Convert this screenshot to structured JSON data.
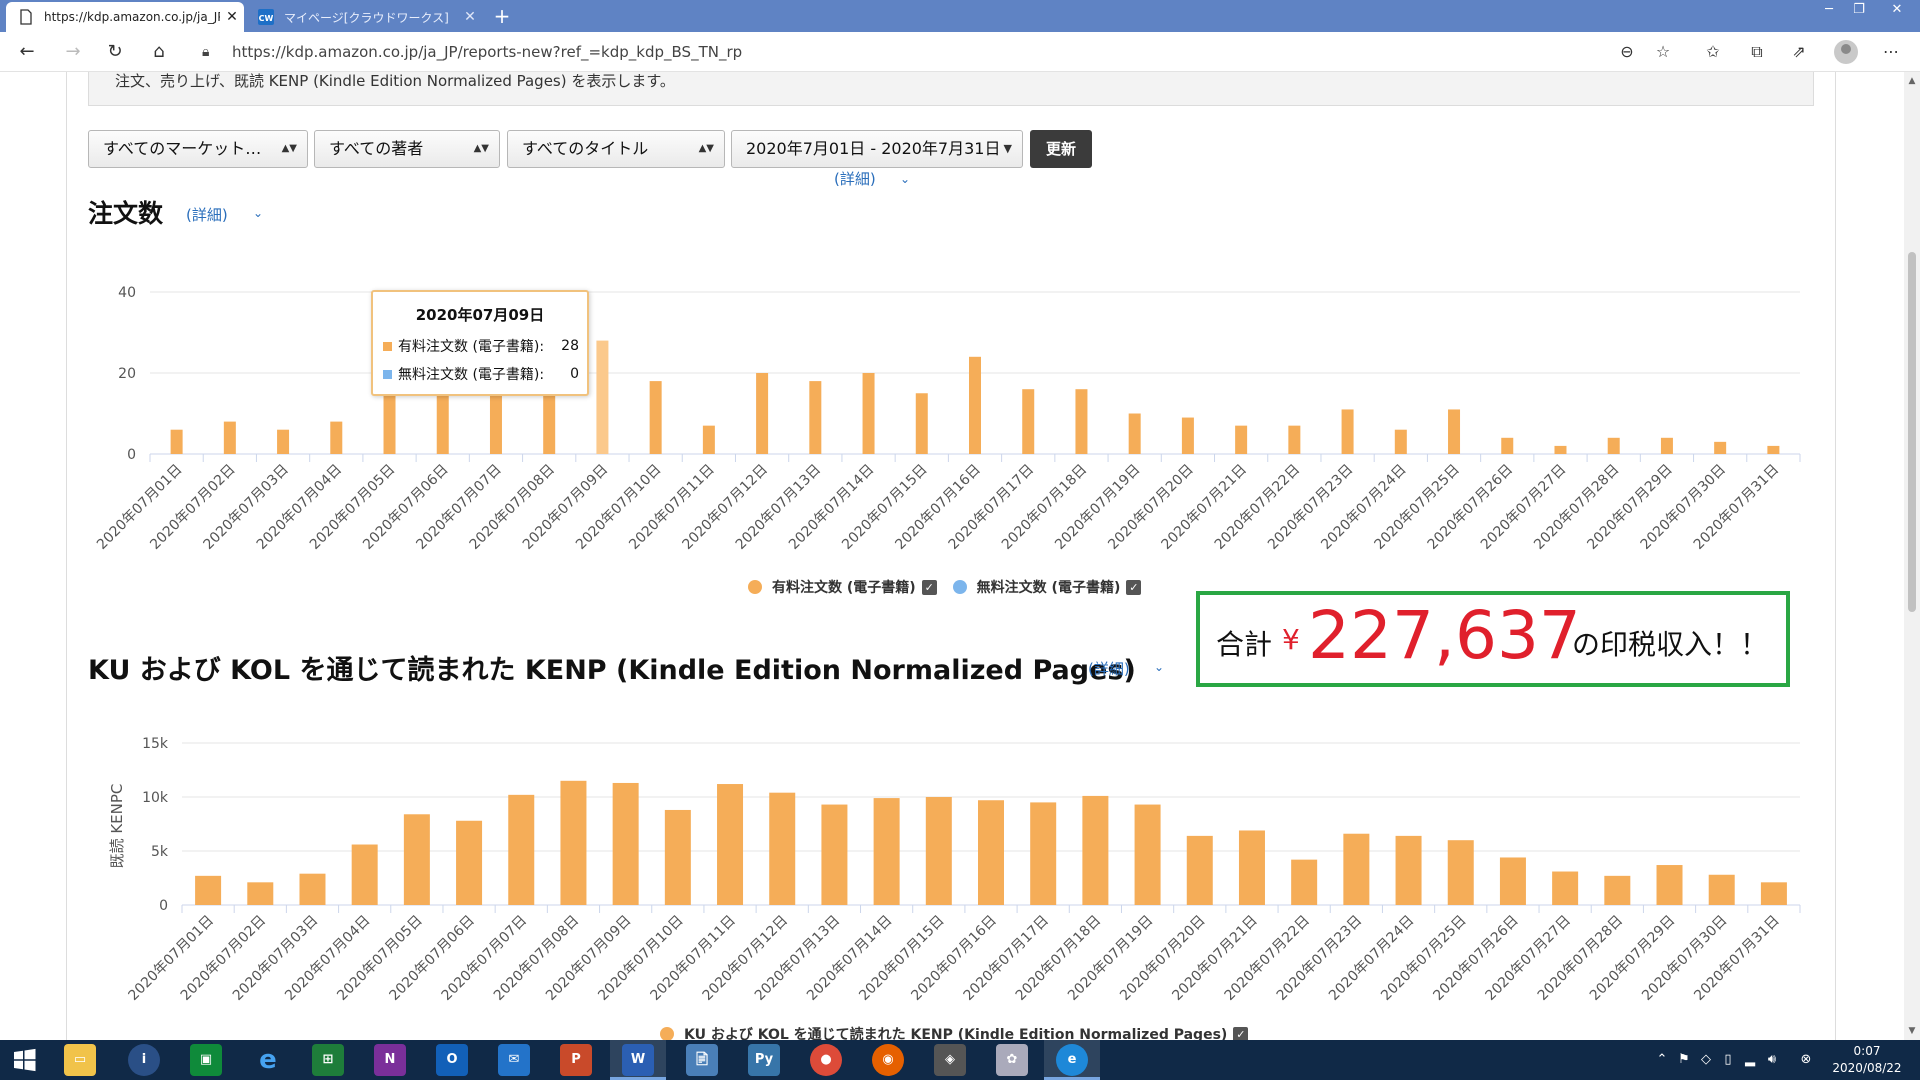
{
  "browser": {
    "tabs": [
      {
        "title": "https://kdp.amazon.co.jp/ja_JP/re",
        "active": true
      },
      {
        "title": "マイページ[クラウドワークス]",
        "active": false
      }
    ],
    "new_tab_label": "+",
    "url": "https://kdp.amazon.co.jp/ja_JP/reports-new?ref_=kdp_kdp_BS_TN_rp",
    "window_controls": [
      "─",
      "❐",
      "✕"
    ]
  },
  "page": {
    "info_text": "注文、売り上げ、既読 KENP (Kindle Edition Normalized Pages) を表示します。",
    "filters": {
      "marketplace": "すべてのマーケット…",
      "author": "すべての著者",
      "title": "すべてのタイトル",
      "date_range": "2020年7月01日 - 2020年7月31日",
      "update_button": "更新",
      "detail_label": "(詳細)"
    },
    "orders_section": {
      "title": "注文数",
      "detail_label": "(詳細)"
    },
    "kenp_section": {
      "title": "KU および KOL を通じて読まれた KENP (Kindle Edition Normalized Pages)",
      "detail_label": "(詳細)"
    },
    "tooltip": {
      "date": "2020年07月09日",
      "rows": [
        {
          "label": "有料注文数 (電子書籍):",
          "value": "28",
          "color": "#f5ad58"
        },
        {
          "label": "無料注文数 (電子書籍):",
          "value": "0",
          "color": "#7cb5ec"
        }
      ]
    },
    "annotation": {
      "prefix": "合計",
      "currency": "¥",
      "amount": "227,637",
      "suffix": "の印税収入！！"
    }
  },
  "chart_data": [
    {
      "type": "bar",
      "title": "注文数",
      "categories": [
        "2020年07月01日",
        "2020年07月02日",
        "2020年07月03日",
        "2020年07月04日",
        "2020年07月05日",
        "2020年07月06日",
        "2020年07月07日",
        "2020年07月08日",
        "2020年07月09日",
        "2020年07月10日",
        "2020年07月11日",
        "2020年07月12日",
        "2020年07月13日",
        "2020年07月14日",
        "2020年07月15日",
        "2020年07月16日",
        "2020年07月17日",
        "2020年07月18日",
        "2020年07月19日",
        "2020年07月20日",
        "2020年07月21日",
        "2020年07月22日",
        "2020年07月23日",
        "2020年07月24日",
        "2020年07月25日",
        "2020年07月26日",
        "2020年07月27日",
        "2020年07月28日",
        "2020年07月29日",
        "2020年07月30日",
        "2020年07月31日"
      ],
      "series": [
        {
          "name": "有料注文数 (電子書籍)",
          "color": "#f5ad58",
          "values": [
            6,
            8,
            6,
            8,
            20,
            22,
            22,
            22,
            28,
            18,
            7,
            20,
            18,
            20,
            15,
            24,
            16,
            16,
            10,
            9,
            7,
            7,
            11,
            6,
            11,
            4,
            2,
            4,
            4,
            3,
            2
          ]
        },
        {
          "name": "無料注文数 (電子書籍)",
          "color": "#7cb5ec",
          "values": [
            0,
            0,
            0,
            0,
            0,
            0,
            0,
            0,
            0,
            0,
            0,
            0,
            0,
            0,
            0,
            0,
            0,
            0,
            0,
            0,
            0,
            0,
            0,
            0,
            0,
            0,
            0,
            0,
            0,
            0,
            0
          ]
        }
      ],
      "yticks": [
        "0",
        "20",
        "40"
      ],
      "ylim": [
        0,
        40
      ],
      "highlight_index": 8,
      "grid": true,
      "legend": "bottom-center"
    },
    {
      "type": "bar",
      "title": "KU および KOL を通じて読まれた KENP (Kindle Edition Normalized Pages)",
      "ylabel": "既読 KENPC",
      "categories": [
        "2020年07月01日",
        "2020年07月02日",
        "2020年07月03日",
        "2020年07月04日",
        "2020年07月05日",
        "2020年07月06日",
        "2020年07月07日",
        "2020年07月08日",
        "2020年07月09日",
        "2020年07月10日",
        "2020年07月11日",
        "2020年07月12日",
        "2020年07月13日",
        "2020年07月14日",
        "2020年07月15日",
        "2020年07月16日",
        "2020年07月17日",
        "2020年07月18日",
        "2020年07月19日",
        "2020年07月20日",
        "2020年07月21日",
        "2020年07月22日",
        "2020年07月23日",
        "2020年07月24日",
        "2020年07月25日",
        "2020年07月26日",
        "2020年07月27日",
        "2020年07月28日",
        "2020年07月29日",
        "2020年07月30日",
        "2020年07月31日"
      ],
      "series": [
        {
          "name": "KU および KOL を通じて読まれた KENP (Kindle Edition Normalized Pages)",
          "color": "#f5ad58",
          "values": [
            2700,
            2100,
            2900,
            5600,
            8400,
            7800,
            10200,
            11500,
            11300,
            8800,
            11200,
            10400,
            9300,
            9900,
            10000,
            9700,
            9500,
            10100,
            9300,
            6400,
            6900,
            4200,
            6600,
            6400,
            6000,
            4400,
            3100,
            2700,
            3700,
            2800,
            2100
          ]
        }
      ],
      "yticks": [
        "0",
        "5k",
        "10k",
        "15k"
      ],
      "ylim": [
        0,
        15000
      ],
      "grid": true,
      "legend": "bottom-center"
    }
  ],
  "taskbar": {
    "clock_time": "0:07",
    "clock_date": "2020/08/22"
  }
}
